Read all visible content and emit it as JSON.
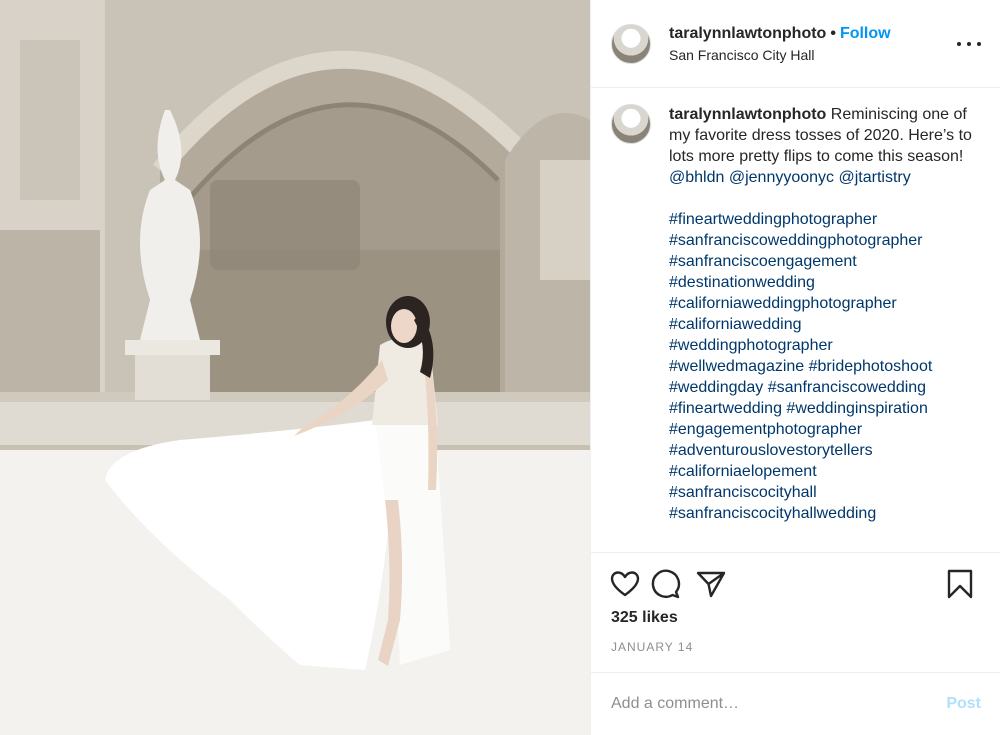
{
  "post": {
    "username": "taralynnlawtonphoto",
    "separator": "•",
    "follow_label": "Follow",
    "location": "San Francisco City Hall",
    "more_icon": "more-options-icon",
    "photo_alt": "Bride in white gown tossing her dress skirt in an ornate arched hall"
  },
  "caption": {
    "username": "taralynnlawtonphoto",
    "text": "Reminiscing one of my favorite dress tosses of 2020. Here’s to lots more pretty flips to come this season!",
    "mention1": "@bhldn",
    "mention2": "@jennyyoonyc",
    "mention3": "@jtartistry",
    "hashtag_lines": [
      "#fineartweddingphotographer",
      "#sanfranciscoweddingphotographer",
      "#sanfranciscoengagement",
      "#destinationwedding",
      "#californiaweddingphotographer",
      "#californiawedding",
      "#weddingphotographer",
      "#wellwedmagazine #bridephotoshoot",
      "#weddingday #sanfranciscowedding",
      "#fineartwedding #weddinginspiration",
      "#engagementphotographer",
      "#adventurouslovestorytellers",
      "#californiaelopement",
      "#sanfranciscocityhall",
      "#sanfranciscocityhallwedding"
    ]
  },
  "actions": {
    "icons": [
      "heart-icon",
      "comment-icon",
      "share-icon",
      "bookmark-icon"
    ],
    "likes": "325 likes",
    "date": "JANUARY 14"
  },
  "comment": {
    "placeholder": "Add a comment…",
    "post_label": "Post"
  },
  "colors": {
    "link": "#00376b",
    "follow": "#0095f6",
    "post_disabled": "#b2dffc",
    "muted": "#8e8e8e"
  }
}
